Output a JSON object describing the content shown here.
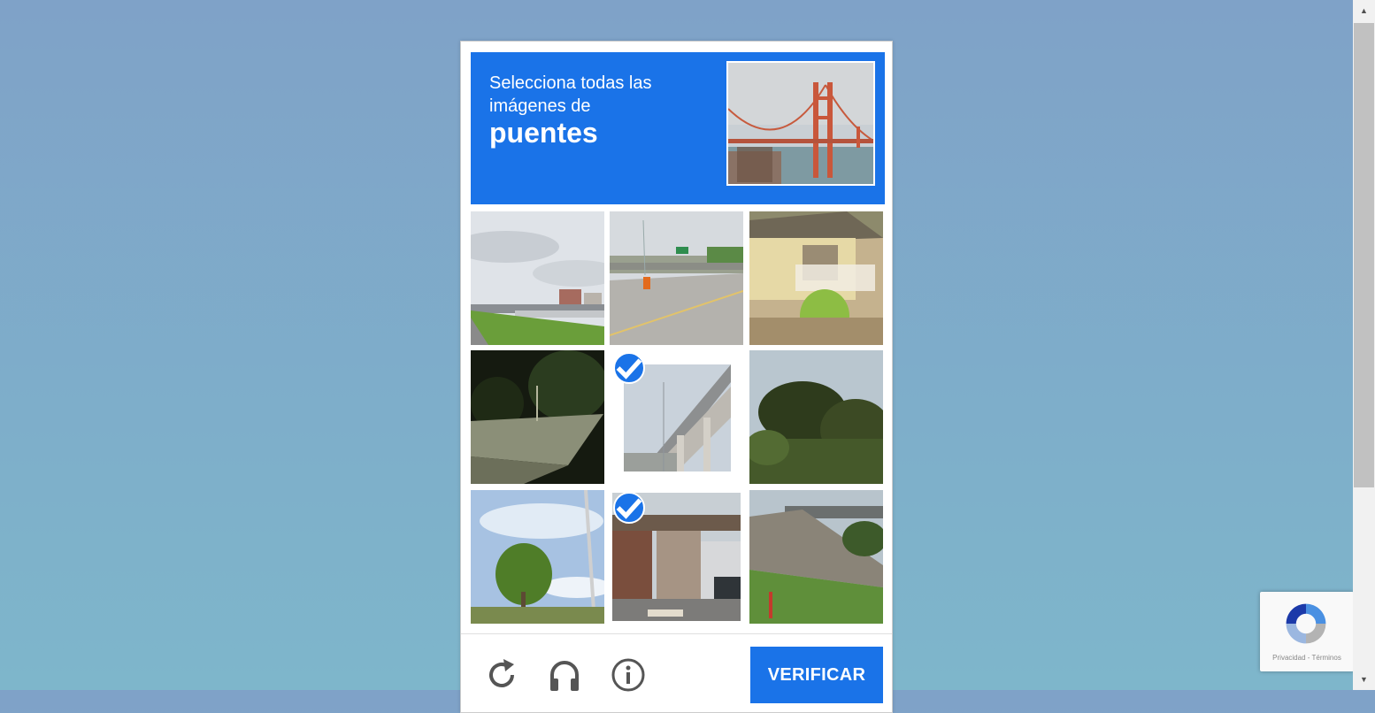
{
  "captcha": {
    "instruction": "Selecciona todas las imágenes de",
    "keyword": "puentes",
    "verify_label": "VERIFICAR",
    "accent_color": "#1a73e8",
    "tiles": [
      {
        "scene": "sky-parking-lot",
        "selected": false
      },
      {
        "scene": "highway-overpass",
        "selected": false
      },
      {
        "scene": "house-porch",
        "selected": false
      },
      {
        "scene": "satellite-dish-night",
        "selected": false
      },
      {
        "scene": "elevated-highway-bridge",
        "selected": true
      },
      {
        "scene": "trees-sky",
        "selected": false
      },
      {
        "scene": "tree-pole",
        "selected": false
      },
      {
        "scene": "railway-bridge-street",
        "selected": true
      },
      {
        "scene": "overpass-embankment",
        "selected": false
      }
    ],
    "tools": [
      {
        "name": "reload-icon"
      },
      {
        "name": "headphones-icon"
      },
      {
        "name": "info-icon"
      }
    ]
  },
  "badge": {
    "links": "Privacidad - Términos"
  }
}
